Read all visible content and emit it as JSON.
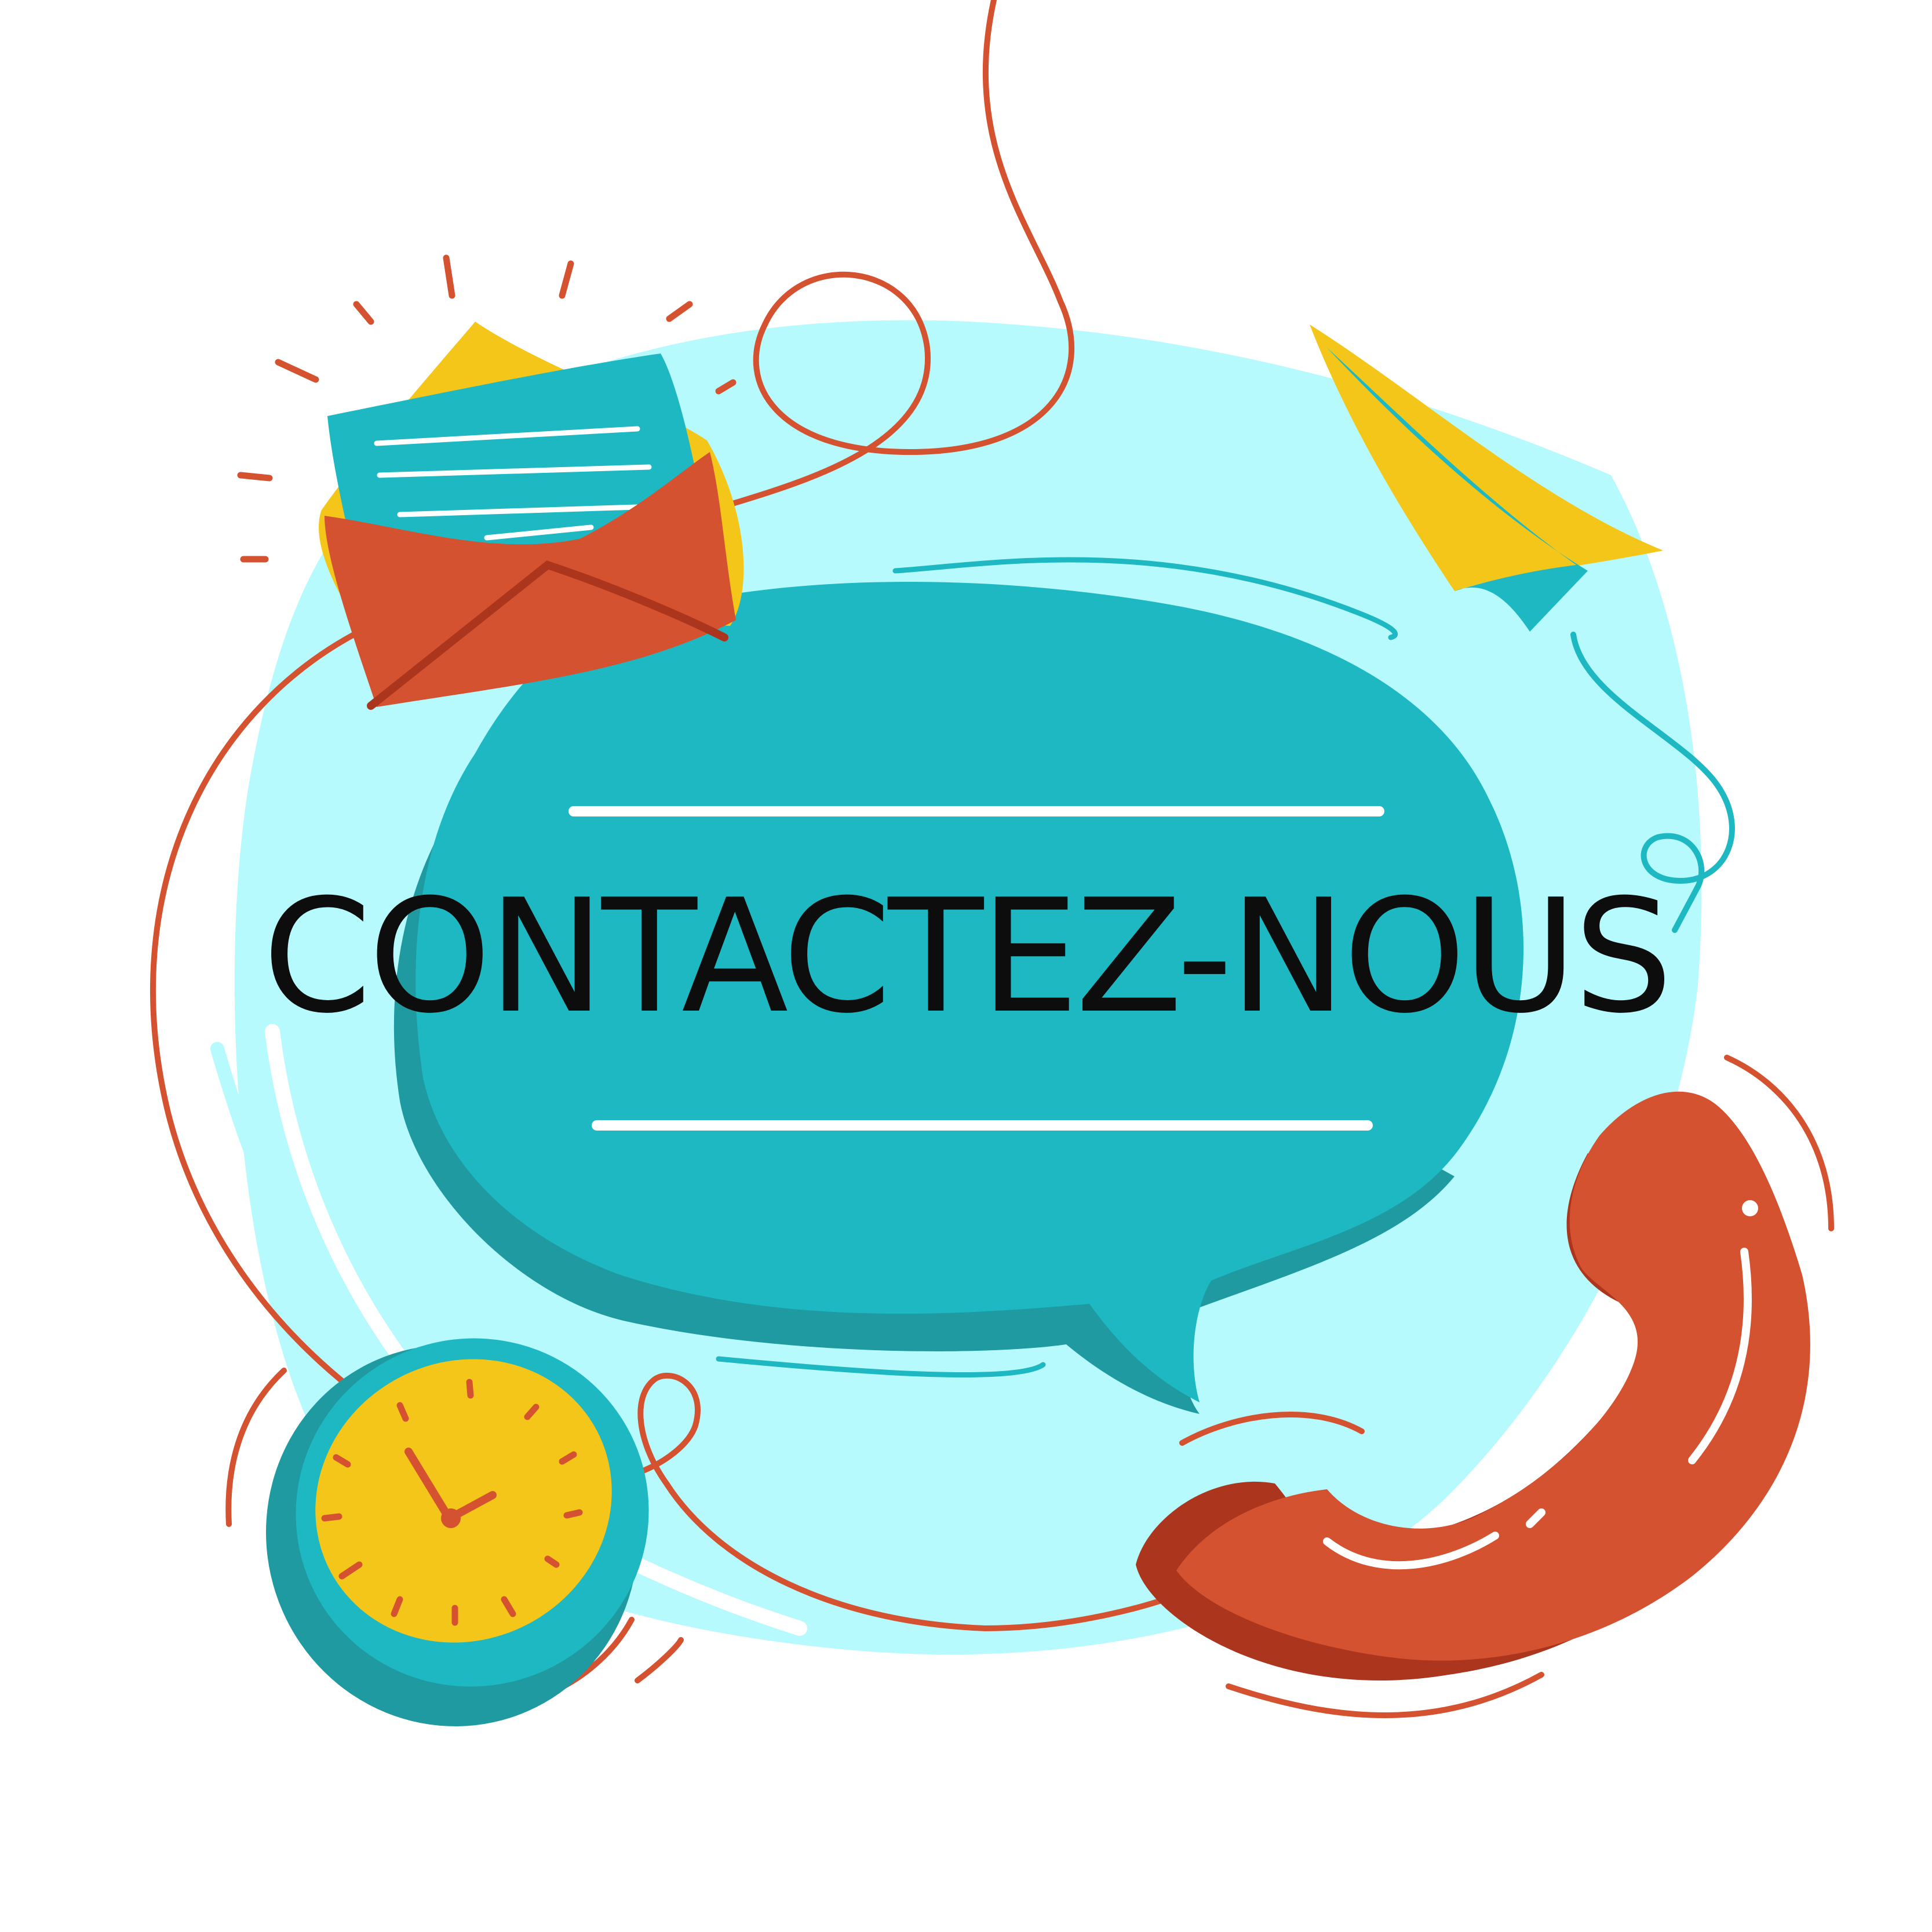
{
  "headline": "CONTACTEZ-NOUS",
  "icons": [
    "envelope-icon",
    "paper-plane-icon",
    "speech-bubble-icon",
    "clock-icon",
    "telephone-handset-icon"
  ],
  "colors": {
    "background": "#ffffff",
    "blob": "#b7fafd",
    "teal": "#1db8c2",
    "teal_dark": "#1f9aa1",
    "orange": "#d55230",
    "orange_dark": "#ab351d",
    "yellow": "#f4c61a",
    "text": "#0d0d0d"
  }
}
